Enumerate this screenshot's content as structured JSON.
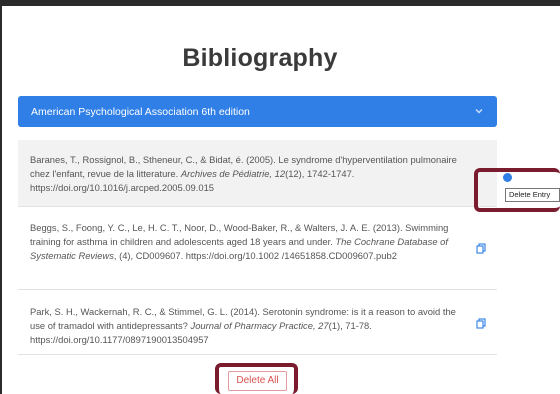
{
  "page": {
    "title": "Bibliography"
  },
  "style_select": {
    "selected": "American Psychological Association 6th edition"
  },
  "entries": [
    {
      "before": "Baranes, T., Rossignol, B., Stheneur, C., & Bidat, é. (2005). Le syndrome d'hyperventilation pulmonaire chez l'enfant, revue de la litterature. ",
      "journal": "Archives de Pédiatrie, 12",
      "after": "(12), 1742-1747. https://doi.org/10.1016/j.arcped.2005.09.015"
    },
    {
      "before": "Beggs, S., Foong, Y. C., Le, H. C. T., Noor, D., Wood-Baker, R., & Walters, J. A. E. (2013). Swimming training for asthma in children and adolescents aged 18 years and under. ",
      "journal": "The Cochrane Database of Systematic Reviews",
      "after": ", (4), CD009607. https://doi.org/10.1002 /14651858.CD009607.pub2"
    },
    {
      "before": "Park, S. H., Wackernah, R. C., & Stimmel, G. L. (2014). Serotonin syndrome: is it a reason to avoid the use of tramadol with antidepressants? ",
      "journal": "Journal of Pharmacy Practice, 27",
      "after": "(1), 71-78. https://doi.org/10.1177/0897190013504957"
    }
  ],
  "tooltip": {
    "text": "Delete Entry"
  },
  "actions": {
    "delete_all": "Delete All"
  },
  "colors": {
    "accent": "#2f7fe6",
    "danger": "#d9534f",
    "highlight": "#7a1b2e"
  },
  "icons": {
    "select": "chevron-down-icon",
    "entry_action": "copy-icon",
    "delete": "delete-entry-icon"
  }
}
